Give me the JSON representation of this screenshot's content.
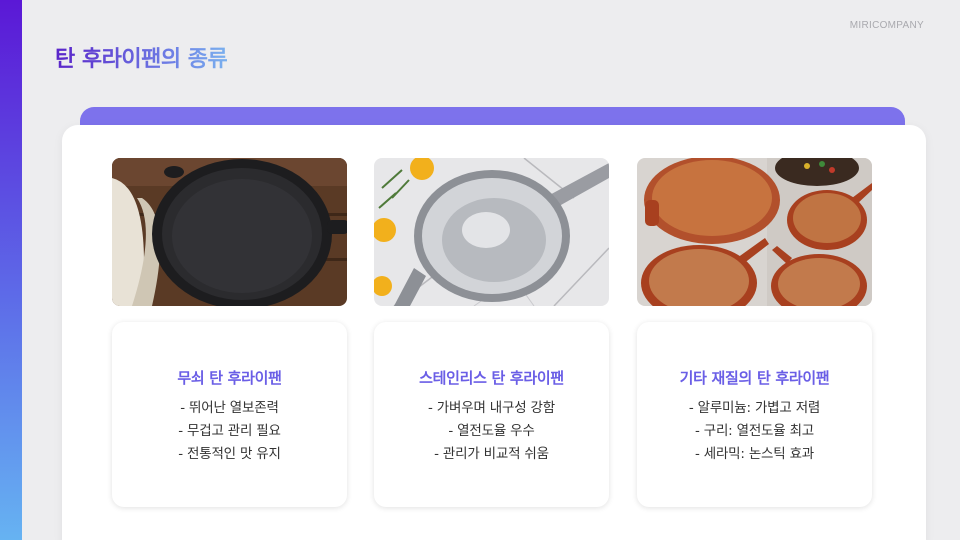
{
  "header": {
    "company": "MIRICOMPANY",
    "title": "탄 후라이팬의 종류"
  },
  "cards": [
    {
      "image_icon": "cast-iron-pan-photo",
      "title": "무쇠 탄 후라이팬",
      "lines": [
        "- 뛰어난 열보존력",
        "- 무겁고 관리 필요",
        "- 전통적인 맛 유지"
      ]
    },
    {
      "image_icon": "stainless-pan-photo",
      "title": "스테인리스 탄 후라이팬",
      "lines": [
        "- 가벼우며 내구성 강함",
        "- 열전도율 우수",
        "- 관리가 비교적 쉬움"
      ]
    },
    {
      "image_icon": "copper-pans-photo",
      "title": "기타 재질의 탄 후라이팬",
      "lines": [
        "- 알루미늄: 가볍고 저렴",
        "- 구리: 열전도율 최고",
        "- 세라믹: 논스틱 효과"
      ]
    }
  ],
  "colors": {
    "accent_purple": "#7d72ec",
    "title_gradient_start": "#5a24c9",
    "card_title": "#6a5ee6"
  }
}
